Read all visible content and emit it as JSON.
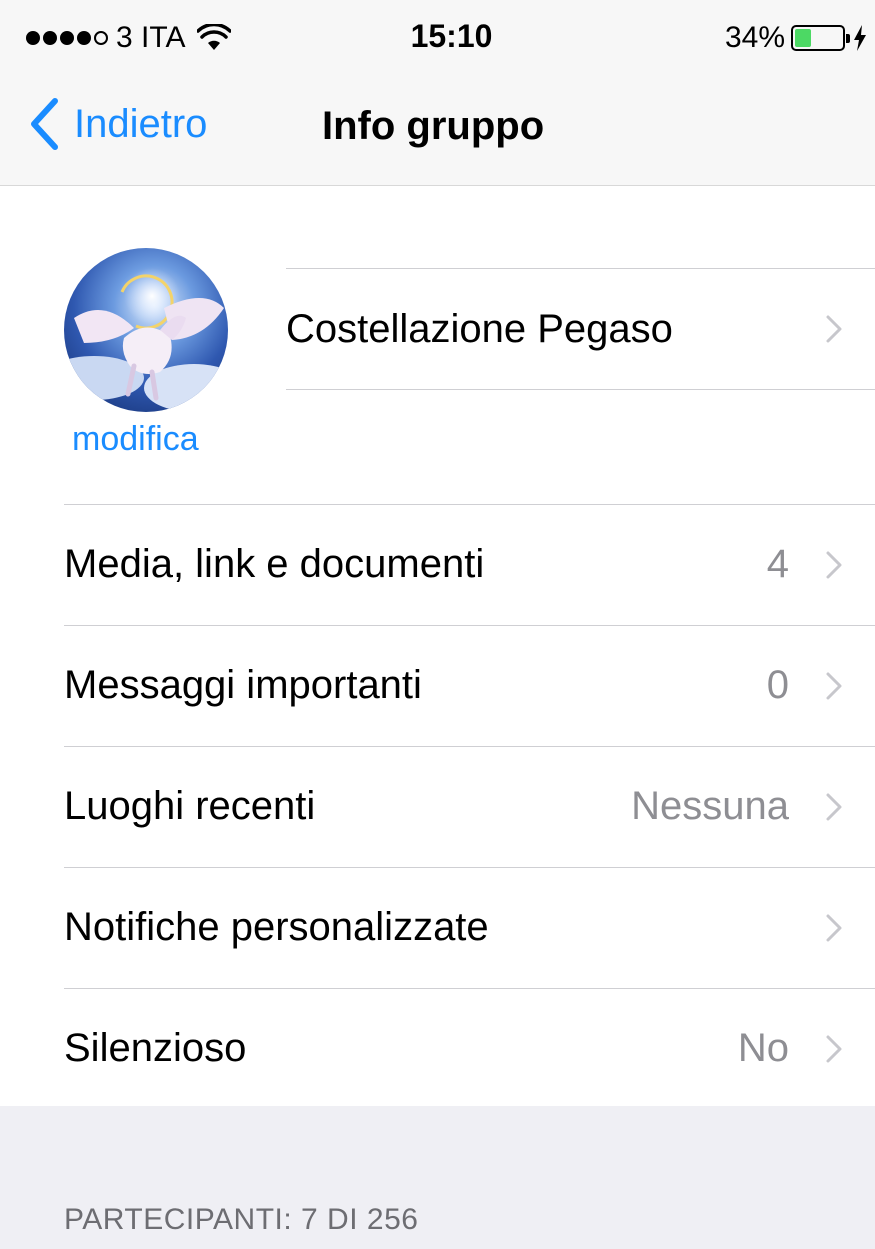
{
  "status_bar": {
    "carrier": "3 ITA",
    "time": "15:10",
    "battery_percent": "34%",
    "battery_level": 0.34,
    "signal_bars": 4,
    "signal_max": 5,
    "battery_color": "#4cd964"
  },
  "nav": {
    "back_label": "Indietro",
    "title": "Info gruppo",
    "accent_color": "#1a8cff"
  },
  "group": {
    "name": "Costellazione Pegaso",
    "edit_label": "modifica",
    "avatar_icon": "pegasus-avatar"
  },
  "rows": [
    {
      "label": "Media, link e documenti",
      "value": "4"
    },
    {
      "label": "Messaggi importanti",
      "value": "0"
    },
    {
      "label": "Luoghi recenti",
      "value": "Nessuna"
    },
    {
      "label": "Notifiche personalizzate",
      "value": ""
    },
    {
      "label": "Silenzioso",
      "value": "No"
    }
  ],
  "participants_header": "PARTECIPANTI: 7 DI 256"
}
